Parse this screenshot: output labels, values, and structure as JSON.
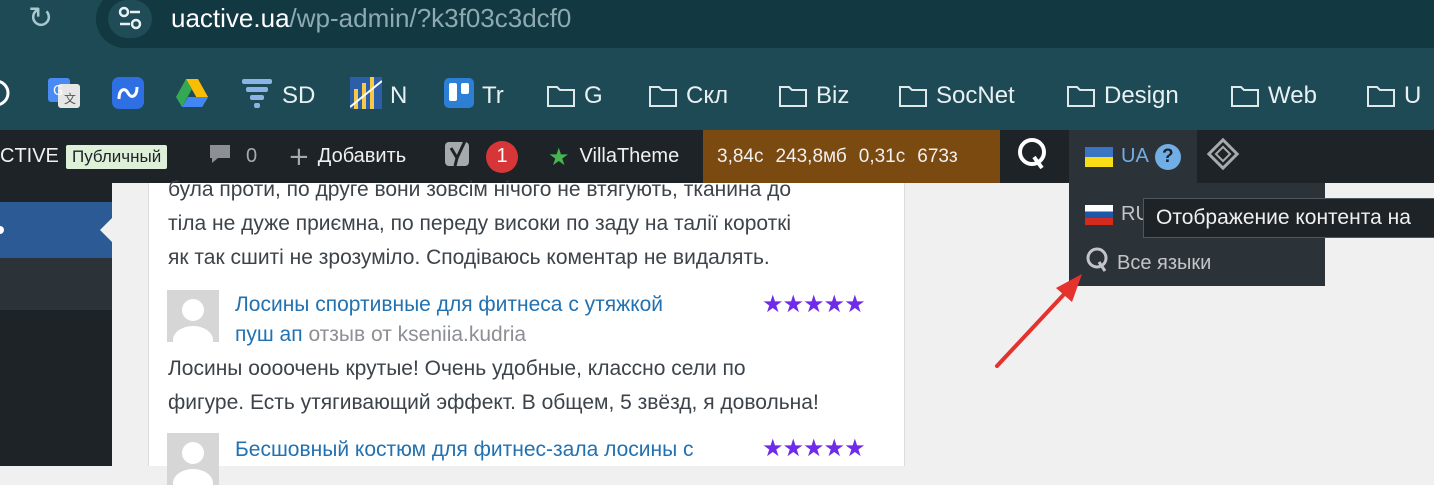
{
  "browser": {
    "url_host": "uactive.ua",
    "url_path": "/wp-admin/?k3f03c3dcf0"
  },
  "bookmarks": [
    {
      "label": "",
      "icon": "chatgpt-icon"
    },
    {
      "label": "",
      "icon": "google-translate-icon"
    },
    {
      "label": "",
      "icon": "app-icon"
    },
    {
      "label": "",
      "icon": "google-drive-icon"
    },
    {
      "label": "SD",
      "icon": "tornado-icon"
    },
    {
      "label": "N",
      "icon": "chart-icon"
    },
    {
      "label": "Tr",
      "icon": "trello-icon"
    },
    {
      "label": "G",
      "icon": "folder-icon"
    },
    {
      "label": "Скл",
      "icon": "folder-icon"
    },
    {
      "label": "Biz",
      "icon": "folder-icon"
    },
    {
      "label": "SocNet",
      "icon": "folder-icon"
    },
    {
      "label": "Design",
      "icon": "folder-icon"
    },
    {
      "label": "Web",
      "icon": "folder-icon"
    },
    {
      "label": "U",
      "icon": "folder-icon"
    }
  ],
  "adminbar": {
    "site_name": "CTIVE",
    "public_badge": "Публичный",
    "comments_count": "0",
    "add_label": "Добавить",
    "yoast_count": "1",
    "villatheme_label": "VillaTheme",
    "perf_time": "3,84с",
    "perf_memory": "243,8мб",
    "perf_db_time": "0,31с",
    "perf_queries": "673з",
    "current_lang": "UA"
  },
  "language_menu": {
    "items": [
      {
        "label": "RU"
      },
      {
        "label": "Все языки"
      }
    ],
    "tooltip": "Отображение контента на"
  },
  "reviews": {
    "prev_text_lines": [
      "була проти, по друге вони зовсім нічого не втягують, тканина до",
      "тіла не дуже приємна, по переду високи по заду на талії короткі",
      "як так сшиті не зрозуміло. Сподіваюсь коментар не видалять."
    ],
    "items": [
      {
        "title_line1": "Лосины спортивные для фитнеса с утяжкой",
        "title_line2": "пуш ап",
        "by_text": "отзыв от kseniia.kudria",
        "stars": "★★★★★",
        "text_lines": [
          "Лосины оооочень крутые! Очень удобные, классно сели по",
          "фигуре. Есть утягивающий эффект. В общем, 5 звёзд, я довольна!"
        ]
      },
      {
        "title_line1": "Бесшовный костюм для фитнес-зала лосины с",
        "stars": "★★★★★"
      }
    ]
  },
  "colors": {
    "browser_bg": "#1e4a55",
    "adminbar_bg": "#1d2327",
    "perf_bg": "#7a4a11",
    "star_color": "#6f2be8",
    "link_color": "#2271b1",
    "arrow_color": "#e5322d"
  }
}
